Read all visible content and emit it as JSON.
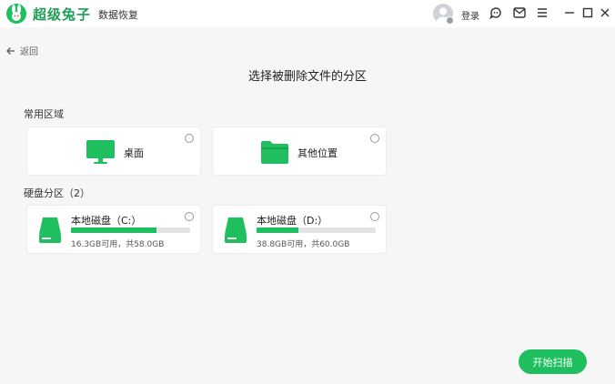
{
  "app": {
    "brand": "超级兔子",
    "subtitle": "数据恢复"
  },
  "header": {
    "login_label": "登录"
  },
  "nav": {
    "back_label": "返回"
  },
  "page": {
    "title": "选择被删除文件的分区"
  },
  "common": {
    "label": "常用区域",
    "items": [
      {
        "label": "桌面",
        "icon": "monitor-icon"
      },
      {
        "label": "其他位置",
        "icon": "folder-icon"
      }
    ]
  },
  "disks": {
    "label": "硬盘分区（2）",
    "items": [
      {
        "name": "本地磁盘（C:）",
        "info": "16.3GB可用，共58.0GB",
        "used_fraction": 0.72
      },
      {
        "name": "本地磁盘（D:）",
        "info": "38.8GB可用，共60.0GB",
        "used_fraction": 0.35
      }
    ]
  },
  "actions": {
    "scan_label": "开始扫描"
  },
  "colors": {
    "accent": "#1fbf5f",
    "brand": "#1f9d55"
  }
}
